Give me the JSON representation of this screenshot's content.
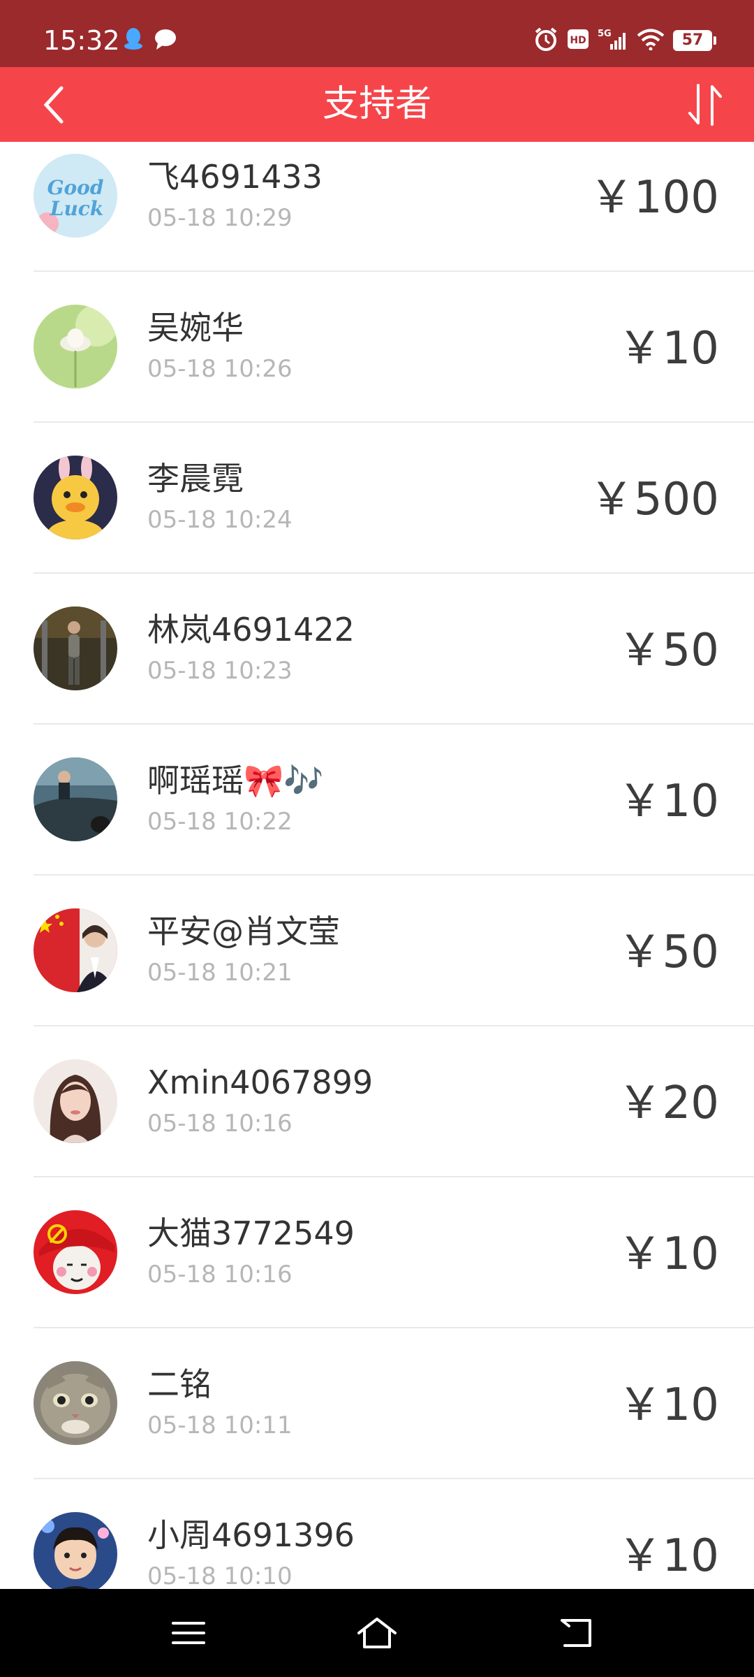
{
  "status_bar": {
    "time": "15:32",
    "battery": "57",
    "network": "5G"
  },
  "header": {
    "title": "支持者"
  },
  "colors": {
    "status_bar": "#9b2a2d",
    "title_bar": "#f5454b"
  },
  "supporters": [
    {
      "name": "飞4691433",
      "time": "05-18 10:29",
      "amount": "￥100",
      "avatar": "good-luck-avatar"
    },
    {
      "name": "吴婉华",
      "time": "05-18 10:26",
      "amount": "￥10",
      "avatar": "lotus-avatar"
    },
    {
      "name": "李晨霓",
      "time": "05-18 10:24",
      "amount": "￥500",
      "avatar": "duck-avatar"
    },
    {
      "name": "林岚4691422",
      "time": "05-18 10:23",
      "amount": "￥50",
      "avatar": "gym-avatar"
    },
    {
      "name": "啊瑶瑶🎀🎶",
      "time": "05-18 10:22",
      "amount": "￥10",
      "avatar": "car-avatar"
    },
    {
      "name": "平安@肖文莹",
      "time": "05-18 10:21",
      "amount": "￥50",
      "avatar": "flag-portrait-avatar"
    },
    {
      "name": "Xmin4067899",
      "time": "05-18 10:16",
      "amount": "￥20",
      "avatar": "girl-portrait-avatar"
    },
    {
      "name": "大猫3772549",
      "time": "05-18 10:16",
      "amount": "￥10",
      "avatar": "red-cap-avatar"
    },
    {
      "name": "二铭",
      "time": "05-18 10:11",
      "amount": "￥10",
      "avatar": "cat-avatar"
    },
    {
      "name": "小周4691396",
      "time": "05-18 10:10",
      "amount": "￥10",
      "avatar": "child-avatar"
    }
  ]
}
